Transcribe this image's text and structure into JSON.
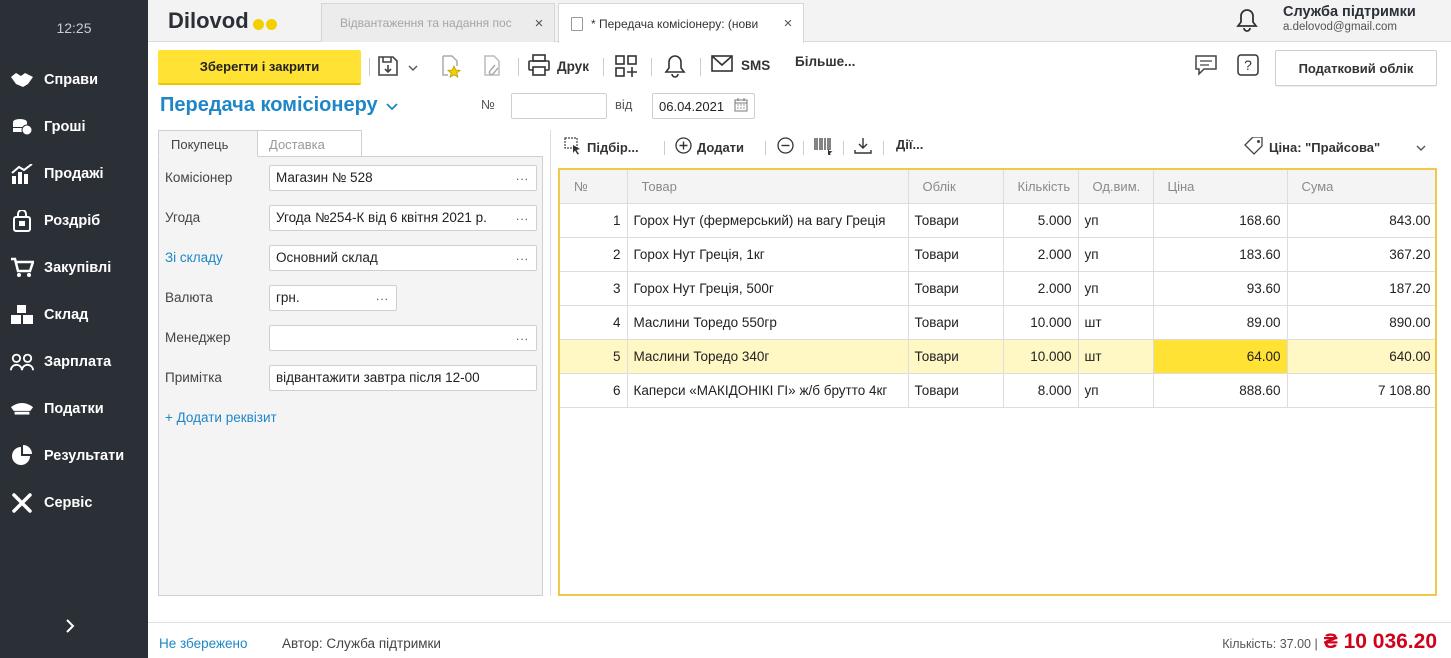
{
  "sidebar": {
    "clock": "12:25",
    "items": [
      {
        "label": "Справи",
        "icon": "handshake-icon"
      },
      {
        "label": "Гроші",
        "icon": "coins-icon"
      },
      {
        "label": "Продажі",
        "icon": "chart-icon"
      },
      {
        "label": "Роздріб",
        "icon": "bag-icon"
      },
      {
        "label": "Закупівлі",
        "icon": "cart-icon"
      },
      {
        "label": "Склад",
        "icon": "boxes-icon"
      },
      {
        "label": "Зарплата",
        "icon": "people-icon"
      },
      {
        "label": "Податки",
        "icon": "officer-cap-icon"
      },
      {
        "label": "Результати",
        "icon": "pie-icon"
      },
      {
        "label": "Сервіс",
        "icon": "tools-icon"
      }
    ]
  },
  "topbar": {
    "logo": "Dilovod",
    "tabs": [
      {
        "title": "Відвантаження та надання пос"
      },
      {
        "title": "* Передача комісіонеру: (нови"
      }
    ],
    "support_name": "Служба підтримки",
    "support_email": "a.delovod@gmail.com"
  },
  "toolbar": {
    "save_close": "Зберегти і закрити",
    "print": "Друк",
    "sms": "SMS",
    "more": "Більше...",
    "tax": "Податковий облік"
  },
  "document": {
    "title": "Передача комісіонеру",
    "number_label": "№",
    "number_value": "",
    "date_label": "від",
    "date_value": "06.04.2021"
  },
  "form": {
    "tabs": [
      "Покупець",
      "Доставка"
    ],
    "fields": [
      {
        "label": "Комісіонер",
        "value": "Магазин № 528"
      },
      {
        "label": "Угода",
        "value": "Угода №254-К від 6 квітня 2021 р."
      },
      {
        "label": "Зі складу",
        "value": "Основний склад"
      },
      {
        "label": "Валюта",
        "value": "грн."
      },
      {
        "label": "Менеджер",
        "value": ""
      },
      {
        "label": "Примітка",
        "value": "відвантажити завтра після 12-00"
      }
    ],
    "add_req": "+ Додати реквізит"
  },
  "grid_toolbar": {
    "pick": "Підбір...",
    "add": "Додати",
    "actions": "Дії...",
    "price": "Ціна: \"Прайсова\""
  },
  "table": {
    "columns": [
      "№",
      "Товар",
      "Облік",
      "Кількість",
      "Од.вим.",
      "Ціна",
      "Сума"
    ],
    "rows": [
      {
        "n": "1",
        "item": "Горох Нут (фермерський) на вагу Греція",
        "acc": "Товари",
        "qty": "5.000",
        "unit": "уп",
        "price": "168.60",
        "sum": "843.00"
      },
      {
        "n": "2",
        "item": "Горох Нут Греція, 1кг",
        "acc": "Товари",
        "qty": "2.000",
        "unit": "уп",
        "price": "183.60",
        "sum": "367.20"
      },
      {
        "n": "3",
        "item": "Горох Нут Греція, 500г",
        "acc": "Товари",
        "qty": "2.000",
        "unit": "уп",
        "price": "93.60",
        "sum": "187.20"
      },
      {
        "n": "4",
        "item": "Маслини Торедо 550гр",
        "acc": "Товари",
        "qty": "10.000",
        "unit": "шт",
        "price": "89.00",
        "sum": "890.00"
      },
      {
        "n": "5",
        "item": "Маслини Торедо 340г",
        "acc": "Товари",
        "qty": "10.000",
        "unit": "шт",
        "price": "64.00",
        "sum": "640.00"
      },
      {
        "n": "6",
        "item": "Каперси «МАКІДОНІКІ ГІ» ж/б брутто 4кг",
        "acc": "Товари",
        "qty": "8.000",
        "unit": "уп",
        "price": "888.60",
        "sum": "7 108.80"
      }
    ]
  },
  "footer": {
    "unsaved": "Не збережено",
    "author": "Автор: Служба підтримки",
    "qty": "Кількість: 37.00 |",
    "sum": "₴ 10 036.20"
  },
  "colors": {
    "accent_yellow": "#ffe233",
    "link_blue": "#1f86c7",
    "total_red": "#d0021b",
    "sidebar_bg": "#2b2f36"
  }
}
